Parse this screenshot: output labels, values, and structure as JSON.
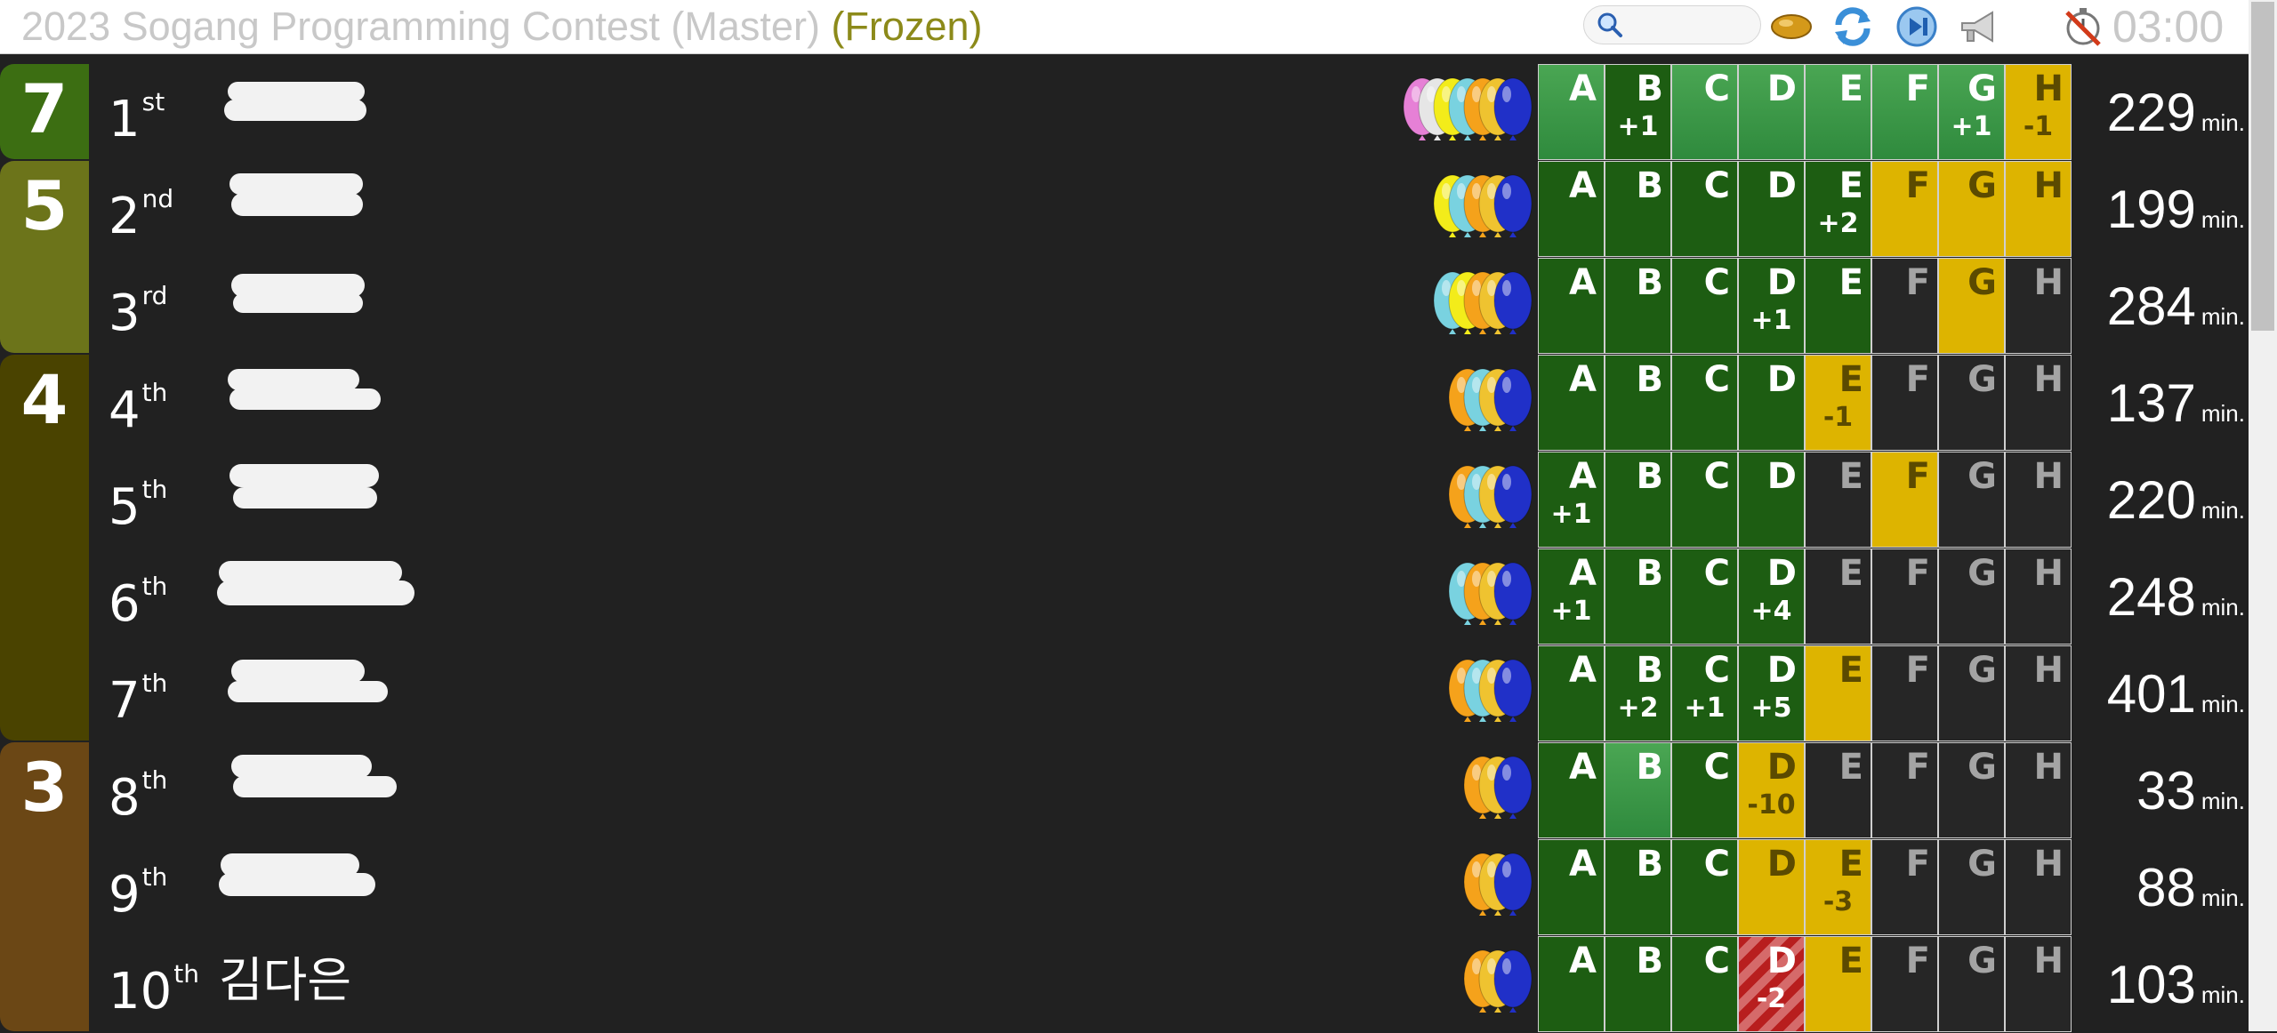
{
  "header": {
    "title": "2023 Sogang Programming Contest (Master)",
    "status": "(Frozen)",
    "search_placeholder": "",
    "clock": "03:00",
    "icons": [
      "search-icon",
      "balloon-icon",
      "refresh-icon",
      "skip-forward-icon",
      "megaphone-icon",
      "timer-off-icon"
    ]
  },
  "colors": {
    "solved": "#1d5d12",
    "first_solve": "#3a9a46",
    "pending": "#ddb400",
    "unsolved": "#262626",
    "wrong": "#b81e1e",
    "group_7": "#3c6e12",
    "group_5": "#6c741a",
    "group_4": "#4a4300",
    "group_3": "#6b4715"
  },
  "problems": [
    "A",
    "B",
    "C",
    "D",
    "E",
    "F",
    "G",
    "H"
  ],
  "groups": [
    {
      "solved": "7",
      "rows": 1
    },
    {
      "solved": "5",
      "rows": 2
    },
    {
      "solved": "4",
      "rows": 4
    },
    {
      "solved": "3",
      "rows": 3
    }
  ],
  "rows": [
    {
      "rank": "1",
      "suffix": "st",
      "name": "",
      "score": "229",
      "unit": "min.",
      "balloons": [
        "#e680d6",
        "#e6e6e6",
        "#f3ec1a",
        "#79d2e0",
        "#f5a21b",
        "#efc330",
        "#2030c8"
      ],
      "cells": [
        {
          "s": "first",
          "t": ""
        },
        {
          "s": "solved",
          "t": "+1"
        },
        {
          "s": "first",
          "t": ""
        },
        {
          "s": "first",
          "t": ""
        },
        {
          "s": "first",
          "t": ""
        },
        {
          "s": "first",
          "t": ""
        },
        {
          "s": "first",
          "t": "+1"
        },
        {
          "s": "pending",
          "t": "-1"
        }
      ]
    },
    {
      "rank": "2",
      "suffix": "nd",
      "name": "",
      "score": "199",
      "unit": "min.",
      "balloons": [
        "#f3ec1a",
        "#79d2e0",
        "#f5a21b",
        "#efc330",
        "#2030c8"
      ],
      "cells": [
        {
          "s": "solved",
          "t": ""
        },
        {
          "s": "solved",
          "t": ""
        },
        {
          "s": "solved",
          "t": ""
        },
        {
          "s": "solved",
          "t": ""
        },
        {
          "s": "solved",
          "t": "+2"
        },
        {
          "s": "pending",
          "t": ""
        },
        {
          "s": "pending",
          "t": ""
        },
        {
          "s": "pending",
          "t": ""
        }
      ]
    },
    {
      "rank": "3",
      "suffix": "rd",
      "name": "",
      "score": "284",
      "unit": "min.",
      "balloons": [
        "#79d2e0",
        "#f3ec1a",
        "#f5a21b",
        "#efc330",
        "#2030c8"
      ],
      "cells": [
        {
          "s": "solved",
          "t": ""
        },
        {
          "s": "solved",
          "t": ""
        },
        {
          "s": "solved",
          "t": ""
        },
        {
          "s": "solved",
          "t": "+1"
        },
        {
          "s": "solved",
          "t": ""
        },
        {
          "s": "unsolved",
          "t": ""
        },
        {
          "s": "pending",
          "t": ""
        },
        {
          "s": "unsolved",
          "t": ""
        }
      ]
    },
    {
      "rank": "4",
      "suffix": "th",
      "name": "",
      "score": "137",
      "unit": "min.",
      "balloons": [
        "#f5a21b",
        "#79d2e0",
        "#efc330",
        "#2030c8"
      ],
      "cells": [
        {
          "s": "solved",
          "t": ""
        },
        {
          "s": "solved",
          "t": ""
        },
        {
          "s": "solved",
          "t": ""
        },
        {
          "s": "solved",
          "t": ""
        },
        {
          "s": "pending",
          "t": "-1"
        },
        {
          "s": "unsolved",
          "t": ""
        },
        {
          "s": "unsolved",
          "t": ""
        },
        {
          "s": "unsolved",
          "t": ""
        }
      ]
    },
    {
      "rank": "5",
      "suffix": "th",
      "name": "",
      "score": "220",
      "unit": "min.",
      "balloons": [
        "#f5a21b",
        "#79d2e0",
        "#efc330",
        "#2030c8"
      ],
      "cells": [
        {
          "s": "solved",
          "t": "+1"
        },
        {
          "s": "solved",
          "t": ""
        },
        {
          "s": "solved",
          "t": ""
        },
        {
          "s": "solved",
          "t": ""
        },
        {
          "s": "unsolved",
          "t": ""
        },
        {
          "s": "pending",
          "t": ""
        },
        {
          "s": "unsolved",
          "t": ""
        },
        {
          "s": "unsolved",
          "t": ""
        }
      ]
    },
    {
      "rank": "6",
      "suffix": "th",
      "name": "",
      "score": "248",
      "unit": "min.",
      "balloons": [
        "#79d2e0",
        "#f5a21b",
        "#efc330",
        "#2030c8"
      ],
      "cells": [
        {
          "s": "solved",
          "t": "+1"
        },
        {
          "s": "solved",
          "t": ""
        },
        {
          "s": "solved",
          "t": ""
        },
        {
          "s": "solved",
          "t": "+4"
        },
        {
          "s": "unsolved",
          "t": ""
        },
        {
          "s": "unsolved",
          "t": ""
        },
        {
          "s": "unsolved",
          "t": ""
        },
        {
          "s": "unsolved",
          "t": ""
        }
      ]
    },
    {
      "rank": "7",
      "suffix": "th",
      "name": "",
      "score": "401",
      "unit": "min.",
      "balloons": [
        "#f5a21b",
        "#79d2e0",
        "#efc330",
        "#2030c8"
      ],
      "cells": [
        {
          "s": "solved",
          "t": ""
        },
        {
          "s": "solved",
          "t": "+2"
        },
        {
          "s": "solved",
          "t": "+1"
        },
        {
          "s": "solved",
          "t": "+5"
        },
        {
          "s": "pending",
          "t": ""
        },
        {
          "s": "unsolved",
          "t": ""
        },
        {
          "s": "unsolved",
          "t": ""
        },
        {
          "s": "unsolved",
          "t": ""
        }
      ]
    },
    {
      "rank": "8",
      "suffix": "th",
      "name": "",
      "score": "33",
      "unit": "min.",
      "balloons": [
        "#f5a21b",
        "#efc330",
        "#2030c8"
      ],
      "cells": [
        {
          "s": "solved",
          "t": ""
        },
        {
          "s": "first",
          "t": ""
        },
        {
          "s": "solved",
          "t": ""
        },
        {
          "s": "pending",
          "t": "-10"
        },
        {
          "s": "unsolved",
          "t": ""
        },
        {
          "s": "unsolved",
          "t": ""
        },
        {
          "s": "unsolved",
          "t": ""
        },
        {
          "s": "unsolved",
          "t": ""
        }
      ]
    },
    {
      "rank": "9",
      "suffix": "th",
      "name": "",
      "score": "88",
      "unit": "min.",
      "balloons": [
        "#f5a21b",
        "#efc330",
        "#2030c8"
      ],
      "cells": [
        {
          "s": "solved",
          "t": ""
        },
        {
          "s": "solved",
          "t": ""
        },
        {
          "s": "solved",
          "t": ""
        },
        {
          "s": "pending",
          "t": ""
        },
        {
          "s": "pending",
          "t": "-3"
        },
        {
          "s": "unsolved",
          "t": ""
        },
        {
          "s": "unsolved",
          "t": ""
        },
        {
          "s": "unsolved",
          "t": ""
        }
      ]
    },
    {
      "rank": "10",
      "suffix": "th",
      "name": "김다은",
      "score": "103",
      "unit": "min.",
      "balloons": [
        "#f5a21b",
        "#efc330",
        "#2030c8"
      ],
      "cells": [
        {
          "s": "solved",
          "t": ""
        },
        {
          "s": "solved",
          "t": ""
        },
        {
          "s": "solved",
          "t": ""
        },
        {
          "s": "wrong",
          "t": "-2"
        },
        {
          "s": "pending",
          "t": ""
        },
        {
          "s": "unsolved",
          "t": ""
        },
        {
          "s": "unsolved",
          "t": ""
        },
        {
          "s": "unsolved",
          "t": ""
        }
      ]
    }
  ]
}
